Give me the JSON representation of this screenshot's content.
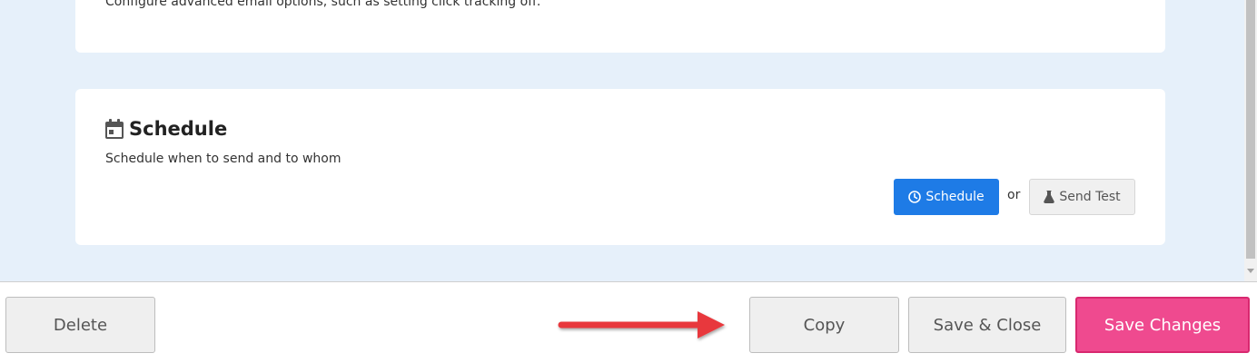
{
  "advanced": {
    "description": "Configure advanced email options, such as setting click tracking off."
  },
  "schedule": {
    "title": "Schedule",
    "description": "Schedule when to send and to whom",
    "icon": "calendar-icon",
    "schedule_button": "Schedule",
    "schedule_button_icon": "clock-icon",
    "or_text": "or",
    "send_test_button": "Send Test",
    "send_test_button_icon": "flask-icon"
  },
  "footer": {
    "delete_label": "Delete",
    "copy_label": "Copy",
    "save_close_label": "Save & Close",
    "save_changes_label": "Save Changes"
  },
  "annotation": {
    "arrow_color": "#e8383d",
    "arrow_target": "Copy"
  },
  "colors": {
    "page_background": "#e6f0fa",
    "primary_blue": "#1e7be6",
    "save_changes_pink": "#ef4a8f"
  }
}
